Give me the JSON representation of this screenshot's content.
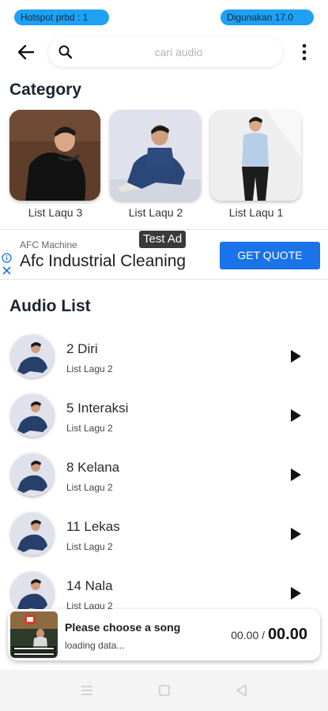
{
  "status_bar": {
    "left_pill": "Hotspot prbd : 1",
    "right_pill": "Digunakan 17.0"
  },
  "search": {
    "placeholder": "cari audio",
    "value": ""
  },
  "category": {
    "title": "Category",
    "items": [
      {
        "label": "List Laqu 3"
      },
      {
        "label": "List Laqu 2"
      },
      {
        "label": "List Laqu 1"
      }
    ]
  },
  "ad": {
    "badge": "Test Ad",
    "advertiser": "AFC Machine",
    "title": "Afc Industrial Cleaning",
    "cta": "GET QUOTE"
  },
  "audio_list": {
    "title": "Audio List",
    "items": [
      {
        "title": "2 Diri",
        "subtitle": "List Lagu 2"
      },
      {
        "title": "5 Interaksi",
        "subtitle": "List Lagu 2"
      },
      {
        "title": "8 Kelana",
        "subtitle": "List Lagu 2"
      },
      {
        "title": "11 Lekas",
        "subtitle": "List Lagu 2"
      },
      {
        "title": "14 Nala",
        "subtitle": "List Lagu 2"
      }
    ]
  },
  "player": {
    "title": "Please choose a song",
    "status": "loading data...",
    "current_time": "00.00",
    "separator": "/",
    "total_time": "00.00"
  },
  "colors": {
    "pill": "#1ea1f3",
    "ad_cta": "#1a73e8",
    "artist_jacket": "#27406b"
  },
  "icons": [
    "back-arrow-icon",
    "search-icon",
    "more-vert-icon",
    "play-icon",
    "ad-info-icon",
    "ad-close-icon",
    "nav-menu-icon",
    "nav-home-icon",
    "nav-back-icon"
  ]
}
